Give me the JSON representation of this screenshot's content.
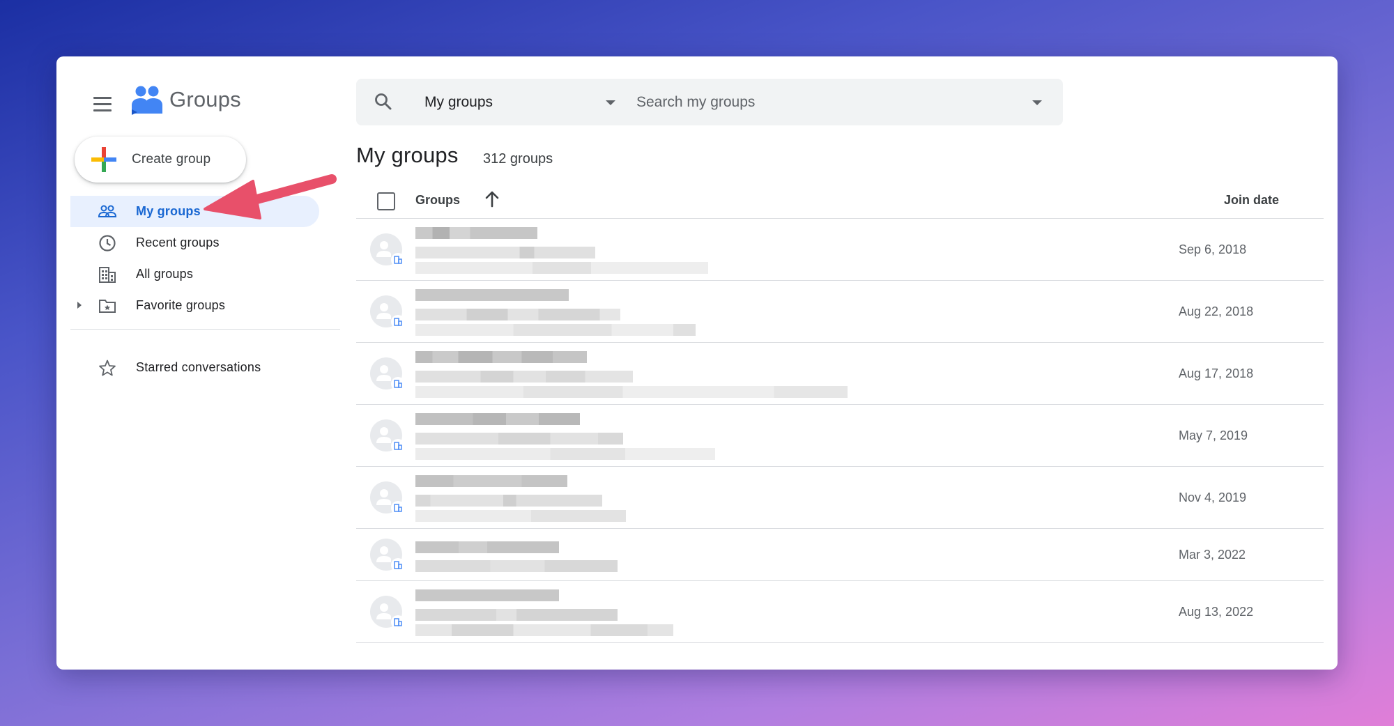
{
  "app": {
    "name": "Groups"
  },
  "sidebar": {
    "create_label": "Create group",
    "items": [
      {
        "label": "My groups",
        "icon": "people-icon",
        "active": true
      },
      {
        "label": "Recent groups",
        "icon": "clock-icon",
        "active": false
      },
      {
        "label": "All groups",
        "icon": "building-icon",
        "active": false
      },
      {
        "label": "Favorite groups",
        "icon": "folder-star-icon",
        "active": false
      }
    ],
    "starred_label": "Starred conversations"
  },
  "search": {
    "scope": "My groups",
    "placeholder": "Search my groups"
  },
  "page": {
    "title": "My groups",
    "count": "312 groups"
  },
  "table": {
    "col_groups": "Groups",
    "col_join": "Join date",
    "sort": "ascending",
    "rows": [
      {
        "join_date": "Sep 6, 2018"
      },
      {
        "join_date": "Aug 22, 2018"
      },
      {
        "join_date": "Aug 17, 2018"
      },
      {
        "join_date": "May 7, 2019"
      },
      {
        "join_date": "Nov 4, 2019"
      },
      {
        "join_date": "Mar 3, 2022"
      },
      {
        "join_date": "Aug 13, 2022"
      }
    ]
  },
  "colors": {
    "accent_blue": "#1967d2",
    "active_bg": "#e8f0fe",
    "annotation_arrow": "#e8506a"
  }
}
